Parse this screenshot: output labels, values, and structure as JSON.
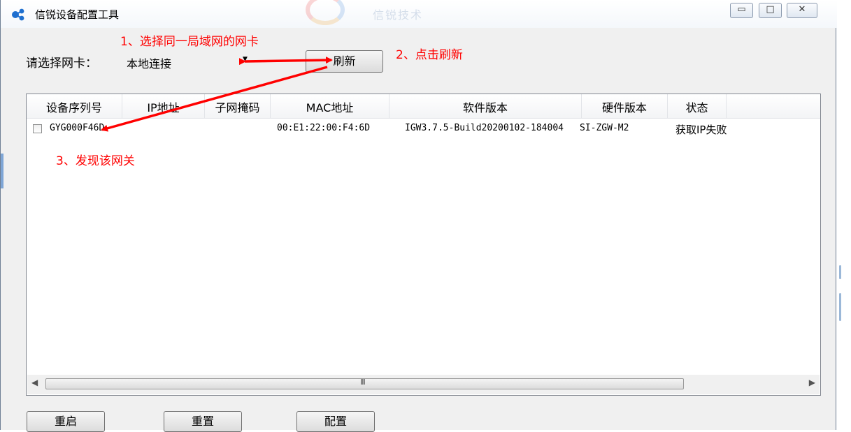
{
  "window": {
    "title": "信锐设备配置工具",
    "background_watermark": "信锐技术",
    "controls": {
      "minimize": "▭",
      "maximize": "□",
      "close": "✕"
    }
  },
  "nic": {
    "label": "请选择网卡：",
    "selected": "本地连接",
    "refresh_label": "刷新"
  },
  "table": {
    "columns": [
      "设备序列号",
      "IP地址",
      "子网掩码",
      "MAC地址",
      "软件版本",
      "硬件版本",
      "状态"
    ],
    "rows": [
      {
        "serial": "GYG000F46D",
        "ip": "",
        "mask": "",
        "mac": "00:E1:22:00:F4:6D",
        "software": "IGW3.7.5-Build20200102-184004",
        "hardware": "SI-ZGW-M2",
        "status": "获取IP失败",
        "checked": false
      }
    ],
    "scroll_grip": "III"
  },
  "buttons": {
    "reboot": "重启",
    "reset": "重置",
    "config": "配置"
  },
  "annotations": {
    "step1": "1、选择同一局域网的网卡",
    "step2": "2、点击刷新",
    "step3": "3、发现该网关",
    "color": "#ff0000"
  },
  "colors": {
    "window_bg": "#f0f0f0",
    "annotation": "#ff0000"
  }
}
